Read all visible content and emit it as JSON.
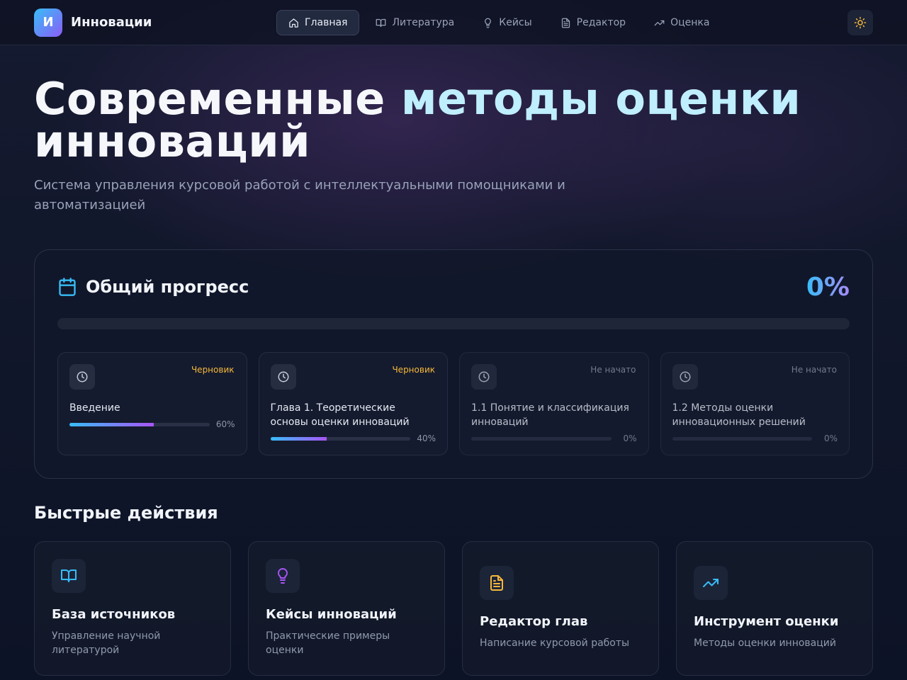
{
  "brand": {
    "logo_letter": "И",
    "name": "Инновации"
  },
  "nav": {
    "items": [
      {
        "label": "Главная",
        "icon": "home-icon",
        "active": true
      },
      {
        "label": "Литература",
        "icon": "book-icon",
        "active": false
      },
      {
        "label": "Кейсы",
        "icon": "lightbulb-icon",
        "active": false
      },
      {
        "label": "Редактор",
        "icon": "document-icon",
        "active": false
      },
      {
        "label": "Оценка",
        "icon": "trending-up-icon",
        "active": false
      }
    ],
    "theme_icon": "sun-icon"
  },
  "hero": {
    "title_part1": "Современные",
    "title_part2": "методы оценки",
    "title_part3": "инноваций",
    "subtitle": "Система управления курсовой работой с интеллектуальными помощниками и автоматизацией"
  },
  "progress": {
    "title": "Общий прогресс",
    "percent_label": "0%",
    "percent_value": 0,
    "chapters": [
      {
        "title": "Введение",
        "status": "Черновик",
        "progress": 60,
        "progress_label": "60%"
      },
      {
        "title": "Глава 1. Теоретические основы оценки инноваций",
        "status": "Черновик",
        "progress": 40,
        "progress_label": "40%"
      },
      {
        "title": "1.1 Понятие и классификация инноваций",
        "status": "Не начато",
        "progress": 0,
        "progress_label": "0%"
      },
      {
        "title": "1.2 Методы оценки инновационных решений",
        "status": "Не начато",
        "progress": 0,
        "progress_label": "0%"
      }
    ]
  },
  "quick_actions": {
    "title": "Быстрые действия",
    "cards": [
      {
        "name": "База источников",
        "desc": "Управление научной литературой",
        "icon": "book-icon",
        "color": "#38bdf8"
      },
      {
        "name": "Кейсы инноваций",
        "desc": "Практические примеры оценки",
        "icon": "lightbulb-icon",
        "color": "#a855f7"
      },
      {
        "name": "Редактор глав",
        "desc": "Написание курсовой работы",
        "icon": "document-icon",
        "color": "#f5b73b"
      },
      {
        "name": "Инструмент оценки",
        "desc": "Методы оценки инноваций",
        "icon": "trending-up-icon",
        "color": "#38bdf8"
      }
    ]
  },
  "colors": {
    "accent_blue": "#38bdf8",
    "accent_purple": "#a855f7",
    "draft": "#f5b73b"
  }
}
